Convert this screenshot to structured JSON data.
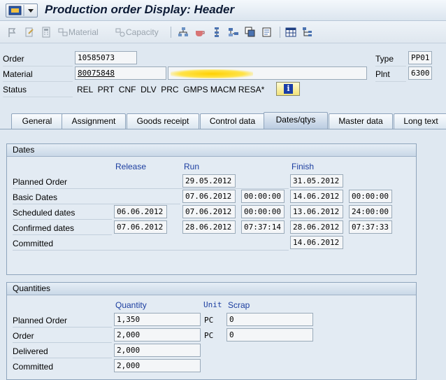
{
  "window": {
    "title": "Production order Display: Header"
  },
  "toolbar": {
    "material_label": "Material",
    "capacity_label": "Capacity"
  },
  "header": {
    "order_label": "Order",
    "order_value": "10585073",
    "type_label": "Type",
    "type_value": "PP01",
    "material_label": "Material",
    "material_value": "80075848",
    "plant_label": "Plnt",
    "plant_value": "6300",
    "status_label": "Status",
    "status_value": "REL  PRT  CNF  DLV  PRC  GMPS MACM RESA*"
  },
  "tabs": [
    "General",
    "Assignment",
    "Goods receipt",
    "Control data",
    "Dates/qtys",
    "Master data",
    "Long text"
  ],
  "active_tab": "Dates/qtys",
  "dates": {
    "group_title": "Dates",
    "col_release": "Release",
    "col_run": "Run",
    "col_finish": "Finish",
    "rows": [
      {
        "label": "Planned Order",
        "release": "",
        "run_date": "29.05.2012",
        "run_time": "",
        "finish_date": "31.05.2012",
        "finish_time": ""
      },
      {
        "label": "Basic Dates",
        "release": "",
        "run_date": "07.06.2012",
        "run_time": "00:00:00",
        "finish_date": "14.06.2012",
        "finish_time": "00:00:00"
      },
      {
        "label": "Scheduled dates",
        "release": "06.06.2012",
        "run_date": "07.06.2012",
        "run_time": "00:00:00",
        "finish_date": "13.06.2012",
        "finish_time": "24:00:00"
      },
      {
        "label": "Confirmed dates",
        "release": "07.06.2012",
        "run_date": "28.06.2012",
        "run_time": "07:37:14",
        "finish_date": "28.06.2012",
        "finish_time": "07:37:33"
      },
      {
        "label": "Committed",
        "release": "",
        "run_date": "",
        "run_time": "",
        "finish_date": "14.06.2012",
        "finish_time": ""
      }
    ]
  },
  "quantities": {
    "group_title": "Quantities",
    "col_quantity": "Quantity",
    "col_unit": "Unit",
    "col_scrap": "Scrap",
    "rows": [
      {
        "label": "Planned Order",
        "quantity": "1,350",
        "unit": "PC",
        "scrap": "0"
      },
      {
        "label": "Order",
        "quantity": "2,000",
        "unit": "PC",
        "scrap": "0"
      },
      {
        "label": "Delivered",
        "quantity": "2,000",
        "unit": "",
        "scrap": ""
      },
      {
        "label": "Committed",
        "quantity": "2,000",
        "unit": "",
        "scrap": ""
      }
    ]
  },
  "colors": {
    "accent": "#1c3ea0",
    "background": "#dfe8f1"
  }
}
